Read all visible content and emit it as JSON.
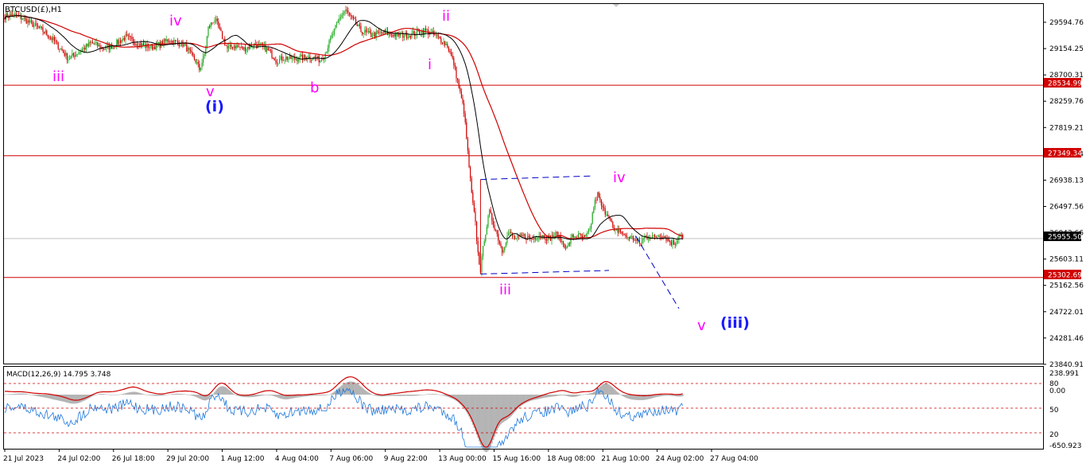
{
  "window": {
    "symbol_title": "BTCUSD(£),H1"
  },
  "colors": {
    "background": "#ffffff",
    "frame": "#000000",
    "bull_candle": "#22aa22",
    "bear_candle": "#d00000",
    "level_line": "#d00000",
    "ma_slow": "#d00000",
    "ma_fast": "#000000",
    "current_price_line": "#c0c0c0",
    "channel_line": "#0000c8",
    "wave_minor": "#ff00ff",
    "wave_intermediate": "#1a1aff",
    "macd_histogram": "#b4b4b4",
    "macd_main": "#1e78dc",
    "macd_signal": "#d00000",
    "macd_level": "#d00000",
    "price_tag_bg": "#d00000",
    "current_tag_bg": "#000000",
    "tag_text": "#ffffff"
  },
  "chart_data": [
    {
      "type": "candlestick",
      "title": "",
      "x_ticks": [
        "21 Jul 2023",
        "24 Jul 02:00",
        "26 Jul 18:00",
        "29 Jul 20:00",
        "1 Aug 12:00",
        "4 Aug 04:00",
        "7 Aug 06:00",
        "9 Aug 22:00",
        "13 Aug 00:00",
        "15 Aug 16:00",
        "18 Aug 08:00",
        "21 Aug 10:00",
        "24 Aug 02:00",
        "27 Aug 04:00"
      ],
      "y_ticks": [
        "29594.76",
        "29154.25",
        "28700.31",
        "28259.76",
        "27819.21",
        "27349.34",
        "26938.13",
        "26497.56",
        "26043.66",
        "25603.11",
        "25162.56",
        "24722.01",
        "24281.46",
        "23840.91"
      ],
      "ylim": [
        23840.91,
        29594.76
      ],
      "price_series_anchors": [
        [
          0,
          29700
        ],
        [
          8,
          29710
        ],
        [
          15,
          29650
        ],
        [
          20,
          29580
        ],
        [
          25,
          29520
        ],
        [
          28,
          29480
        ],
        [
          33,
          29400
        ],
        [
          38,
          29300
        ],
        [
          45,
          29120
        ],
        [
          50,
          28980
        ],
        [
          55,
          29050
        ],
        [
          60,
          29120
        ],
        [
          68,
          29250
        ],
        [
          78,
          29150
        ],
        [
          85,
          29200
        ],
        [
          95,
          29350
        ],
        [
          102,
          29260
        ],
        [
          110,
          29200
        ],
        [
          116,
          29180
        ],
        [
          122,
          29220
        ],
        [
          128,
          29300
        ],
        [
          136,
          29250
        ],
        [
          141,
          29220
        ],
        [
          146,
          29060
        ],
        [
          150,
          28950
        ],
        [
          153,
          28800
        ],
        [
          157,
          29050
        ],
        [
          160,
          29500
        ],
        [
          165,
          29650
        ],
        [
          170,
          29400
        ],
        [
          175,
          29150
        ],
        [
          180,
          29200
        ],
        [
          188,
          29150
        ],
        [
          196,
          29220
        ],
        [
          203,
          29180
        ],
        [
          208,
          29100
        ],
        [
          214,
          28950
        ],
        [
          220,
          29000
        ],
        [
          228,
          28980
        ],
        [
          238,
          29010
        ],
        [
          244,
          29000
        ],
        [
          248,
          28960
        ],
        [
          252,
          29080
        ],
        [
          256,
          29300
        ],
        [
          260,
          29500
        ],
        [
          264,
          29700
        ],
        [
          268,
          29800
        ],
        [
          273,
          29650
        ],
        [
          280,
          29450
        ],
        [
          288,
          29380
        ],
        [
          298,
          29420
        ],
        [
          308,
          29380
        ],
        [
          318,
          29380
        ],
        [
          324,
          29420
        ],
        [
          330,
          29460
        ],
        [
          336,
          29400
        ],
        [
          343,
          29300
        ],
        [
          348,
          29200
        ],
        [
          353,
          28900
        ],
        [
          357,
          28500
        ],
        [
          361,
          28100
        ],
        [
          364,
          27400
        ],
        [
          367,
          26700
        ],
        [
          370,
          26200
        ],
        [
          372,
          25700
        ],
        [
          374,
          25430
        ],
        [
          377,
          25960
        ],
        [
          381,
          26400
        ],
        [
          386,
          26100
        ],
        [
          391,
          25750
        ],
        [
          396,
          26050
        ],
        [
          402,
          25950
        ],
        [
          408,
          26000
        ],
        [
          414,
          25950
        ],
        [
          420,
          26020
        ],
        [
          428,
          25960
        ],
        [
          434,
          26030
        ],
        [
          438,
          25900
        ],
        [
          442,
          25800
        ],
        [
          446,
          25990
        ],
        [
          451,
          26000
        ],
        [
          456,
          25960
        ],
        [
          460,
          26100
        ],
        [
          463,
          26500
        ],
        [
          466,
          26700
        ],
        [
          470,
          26450
        ],
        [
          475,
          26350
        ],
        [
          479,
          26050
        ],
        [
          483,
          26100
        ],
        [
          487,
          26000
        ],
        [
          491,
          25980
        ],
        [
          495,
          25950
        ],
        [
          499,
          25870
        ],
        [
          503,
          25980
        ],
        [
          507,
          26000
        ],
        [
          511,
          25970
        ],
        [
          515,
          26030
        ],
        [
          519,
          25990
        ],
        [
          523,
          25900
        ],
        [
          527,
          25880
        ],
        [
          531,
          26050
        ],
        [
          533,
          25955
        ]
      ],
      "horizontal_levels": [
        28534.99,
        27349.34,
        25302.69
      ],
      "current_price": 25955.5,
      "price_tags": {
        "level_1": "28534.99",
        "level_2": "27349.34",
        "level_3": "25302.69",
        "current": "25955.50"
      },
      "wave_labels": {
        "iii_a": "iii",
        "iv_a": "iv",
        "v_a": "v",
        "i_intermediate": "(i)",
        "b": "b",
        "i_minor": "i",
        "ii_minor": "ii",
        "iii_minor": "iii",
        "iv_minor": "iv",
        "v_minor": "v",
        "iii_intermediate": "(iii)"
      },
      "channel": {
        "upper": [
          [
            374,
            26950
          ],
          [
            462,
            27010
          ]
        ],
        "lower": [
          [
            374,
            25360
          ],
          [
            475,
            25420
          ]
        ],
        "projection": [
          [
            496,
            26000
          ],
          [
            530,
            24780
          ]
        ]
      }
    },
    {
      "type": "macd",
      "title": "MACD(12,26,9) 14.795 3.748",
      "y_ticks": [
        "238.991",
        "80",
        "0.00",
        "50",
        "20",
        "-650.923"
      ],
      "levels": [
        "upper",
        "middle",
        "lower"
      ]
    }
  ]
}
